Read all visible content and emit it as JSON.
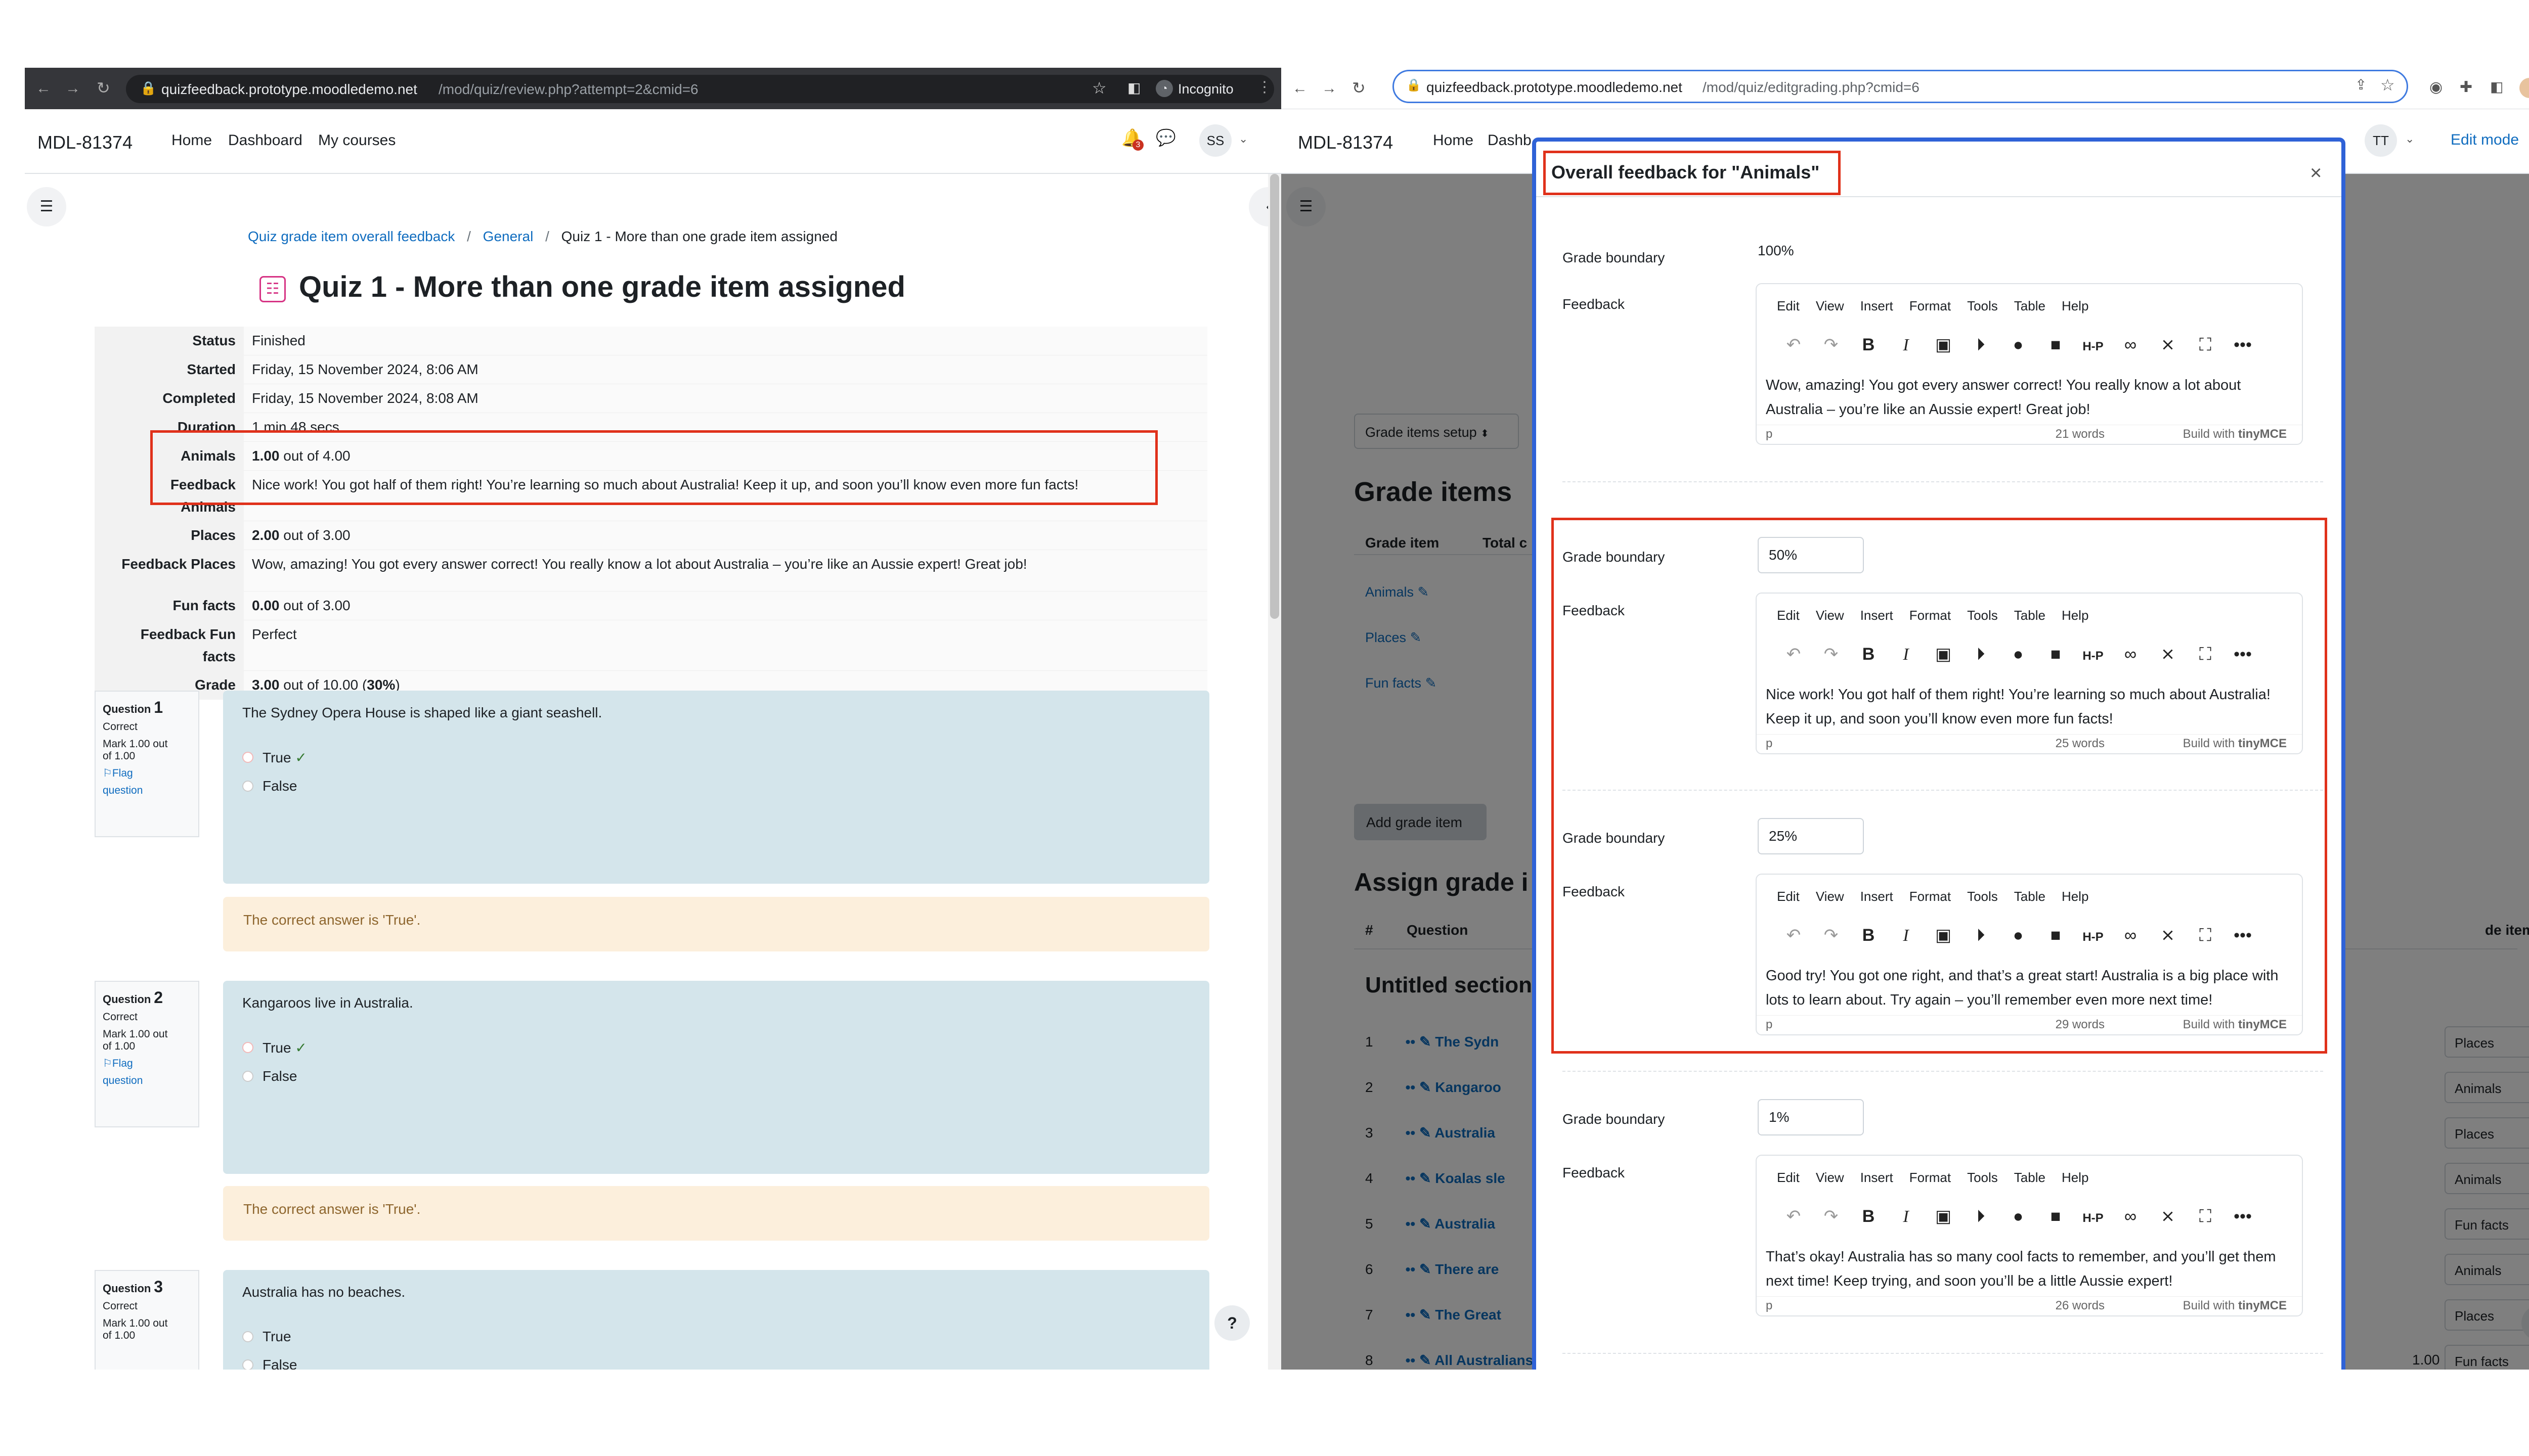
{
  "left": {
    "url_host": "quizfeedback.prototype.moodledemo.net",
    "url_path": "/mod/quiz/review.php?attempt=2&cmid=6",
    "incognito": "Incognito",
    "site": "MDL-81374",
    "nav": [
      "Home",
      "Dashboard",
      "My courses"
    ],
    "notif_count": "3",
    "avatar": "SS",
    "breadcrumb": [
      "Quiz grade item overall feedback",
      "General",
      "Quiz 1 - More than one grade item assigned"
    ],
    "title": "Quiz 1 - More than one grade item assigned",
    "summary": [
      {
        "k": "Status",
        "v": "Finished"
      },
      {
        "k": "Started",
        "v": "Friday, 15 November 2024, 8:06 AM"
      },
      {
        "k": "Completed",
        "v": "Friday, 15 November 2024, 8:08 AM"
      },
      {
        "k": "Duration",
        "v": "1 min 48 secs"
      }
    ],
    "animals": {
      "k": "Animals",
      "score": "1.00",
      "rest": " out of 4.00"
    },
    "fb_animals": {
      "k1": "Feedback",
      "k2": "Animals",
      "v": "Nice work! You got half of them right! You’re learning so much about Australia! Keep it up, and soon you’ll know even more fun facts!"
    },
    "places": {
      "k": "Places",
      "score": "2.00",
      "rest": " out of 3.00"
    },
    "fb_places": {
      "k": "Feedback Places",
      "v": "Wow, amazing! You got every answer correct! You really know a lot about Australia – you’re like an Aussie expert! Great job!"
    },
    "funfacts": {
      "k": "Fun facts",
      "score": "0.00",
      "rest": " out of 3.00"
    },
    "fb_fun": {
      "k1": "Feedback Fun",
      "k2": "facts",
      "v": "Perfect"
    },
    "grade": {
      "k": "Grade",
      "score": "3.00",
      "mid": " out of 10.00 (",
      "pct": "30%",
      "end": ")"
    },
    "questions": [
      {
        "label": "Question",
        "num": "1",
        "state": "Correct",
        "mark1": "Mark 1.00 out",
        "mark2": "of 1.00",
        "flag1": "Flag",
        "flag2": "question",
        "text": "The Sydney Opera House is shaped like a giant seashell.",
        "o1": "True",
        "o2": "False",
        "answer": "The correct answer is 'True'."
      },
      {
        "label": "Question",
        "num": "2",
        "state": "Correct",
        "mark1": "Mark 1.00 out",
        "mark2": "of 1.00",
        "flag1": "Flag",
        "flag2": "question",
        "text": "Kangaroos live in Australia.",
        "o1": "True",
        "o2": "False",
        "answer": "The correct answer is 'True'."
      },
      {
        "label": "Question",
        "num": "3",
        "state": "Correct",
        "mark1": "Mark 1.00 out",
        "mark2": "of 1.00",
        "text": "Australia has no beaches.",
        "o1": "True",
        "o2": "False"
      }
    ],
    "help": "?"
  },
  "right": {
    "url_host": "quizfeedback.prototype.moodledemo.net",
    "url_path": "/mod/quiz/editgrading.php?cmid=6",
    "site": "MDL-81374",
    "nav": [
      "Home",
      "Dashb"
    ],
    "avatar": "TT",
    "edit_mode": "Edit mode",
    "setup_select": "Grade items setup",
    "grade_items_title": "Grade items",
    "col_grade_item": "Grade item",
    "col_total": "Total c",
    "items": [
      "Animals",
      "Places",
      "Fun facts"
    ],
    "add_btn": "Add grade item",
    "assign_title": "Assign grade i",
    "col_hash": "#",
    "col_question": "Question",
    "col_gradeitem": "de item",
    "untitled": "Untitled section",
    "rows": [
      {
        "n": "1",
        "q": "The Sydn",
        "sel": "Places"
      },
      {
        "n": "2",
        "q": "Kangaroo",
        "sel": "Animals"
      },
      {
        "n": "3",
        "q": "Australia",
        "sel": "Places"
      },
      {
        "n": "4",
        "q": "Koalas sle",
        "sel": "Animals"
      },
      {
        "n": "5",
        "q": "Australia",
        "sel": "Fun facts"
      },
      {
        "n": "6",
        "q": "There are",
        "sel": "Animals"
      },
      {
        "n": "7",
        "q": "The Great",
        "sel": "Places"
      },
      {
        "n": "8",
        "q": "All Australians drive on the left side of the road. All Australians drive on the left side of the",
        "mark": "1.00",
        "sel": "Fun facts"
      }
    ],
    "modal": {
      "title": "Overall feedback for \"Animals\"",
      "close": "×",
      "gb_label": "Grade boundary",
      "fb_label": "Feedback",
      "menu": [
        "Edit",
        "View",
        "Insert",
        "Format",
        "Tools",
        "Table",
        "Help"
      ],
      "tools": [
        "↶",
        "↷",
        "B",
        "I",
        "▣",
        "▶",
        "🎤",
        "■",
        "H-P",
        "🔗",
        "⛓",
        "⛶",
        "•••"
      ],
      "build": "Build with",
      "brand": "tinyMCE",
      "p": "p",
      "top": {
        "boundary": "100%",
        "text": "Wow, amazing! You got every answer correct! You really know a lot about Australia – you’re like an Aussie expert! Great job!",
        "words": "21 words"
      },
      "b50": {
        "boundary": "50%",
        "text": "Nice work! You got half of them right! You’re learning so much about Australia! Keep it up, and soon you’ll know even more fun facts!",
        "words": "25 words"
      },
      "b25": {
        "boundary": "25%",
        "text": "Good try! You got one right, and that’s a great start! Australia is a big place with lots to learn about. Try again – you’ll remember even more next time!",
        "words": "29 words"
      },
      "b1": {
        "boundary": "1%",
        "text": "That’s okay! Australia has so many cool facts to remember, and you’ll get them next time! Keep trying, and soon you’ll be a little Aussie expert!",
        "words": "26 words"
      }
    }
  }
}
